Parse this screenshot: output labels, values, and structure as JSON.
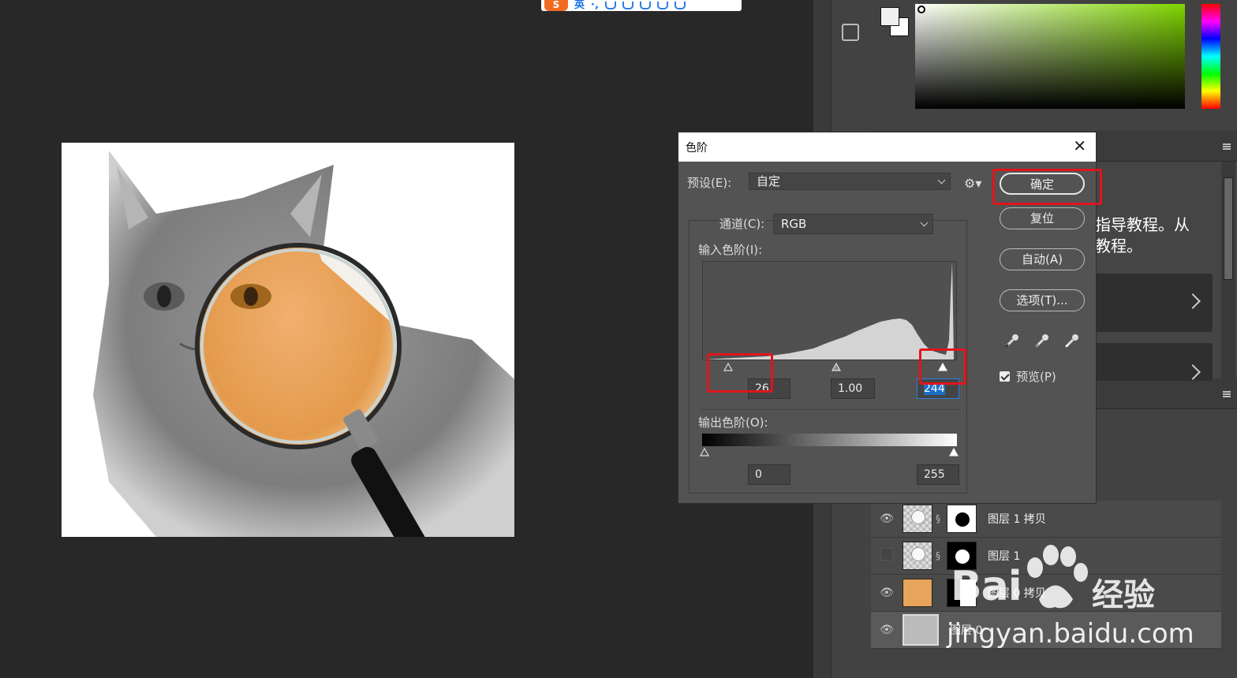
{
  "ime": {
    "logo": "S",
    "mode": "英",
    "punct": "·,"
  },
  "dialog": {
    "title": "色阶",
    "close": "✕",
    "preset_label": "预设(E):",
    "preset_value": "自定",
    "channel_label": "通道(C):",
    "channel_value": "RGB",
    "input_levels_label": "输入色阶(I):",
    "input_black": "26",
    "input_gamma": "1.00",
    "input_white": "244",
    "output_levels_label": "输出色阶(O):",
    "output_black": "0",
    "output_white": "255",
    "buttons": {
      "ok": "确定",
      "reset": "复位",
      "auto": "自动(A)",
      "options": "选项(T)..."
    },
    "preview_label": "预览(P)",
    "preview_checked": true
  },
  "learn": {
    "text_line1": "指导教程。从",
    "text_line2": "教程。"
  },
  "layers": [
    {
      "name": "图层 1 拷贝",
      "visible": true,
      "mask": "white-black-dot",
      "thumb": "magnifier"
    },
    {
      "name": "图层 1",
      "visible": false,
      "mask": "black-white-dot",
      "thumb": "magnifier"
    },
    {
      "name": "图层 0 拷贝",
      "visible": true,
      "mask": "white-black-half",
      "thumb": "orange-cat"
    },
    {
      "name": "图层 0",
      "visible": true,
      "mask": "",
      "thumb": "gray-cat",
      "selected": true
    }
  ],
  "watermark": {
    "brand": "Bai",
    "brand2": "经验",
    "url": "jingyan.baidu.com"
  },
  "colors": {
    "dialog_bg": "#535353",
    "highlight": "#e0141b",
    "ps_dark": "#282828"
  }
}
